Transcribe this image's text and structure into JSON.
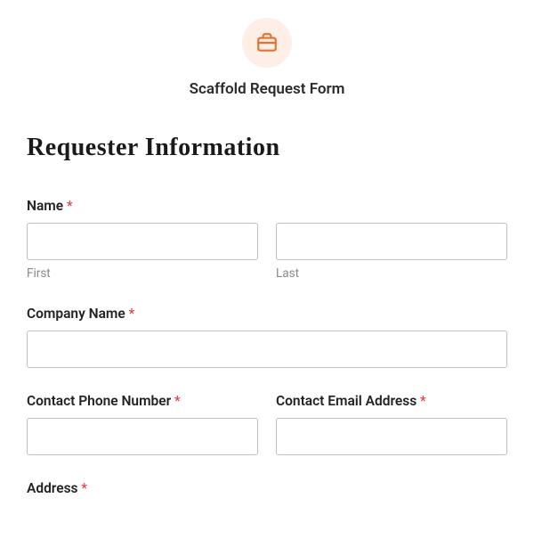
{
  "header": {
    "icon": "briefcase-icon",
    "title": "Scaffold Request Form"
  },
  "section": {
    "heading": "Requester Information"
  },
  "fields": {
    "name": {
      "label": "Name",
      "required": "*",
      "first_sublabel": "First",
      "last_sublabel": "Last"
    },
    "company": {
      "label": "Company Name",
      "required": "*"
    },
    "phone": {
      "label": "Contact Phone Number",
      "required": "*"
    },
    "email": {
      "label": "Contact Email Address",
      "required": "*"
    },
    "address": {
      "label": "Address",
      "required": "*"
    }
  }
}
